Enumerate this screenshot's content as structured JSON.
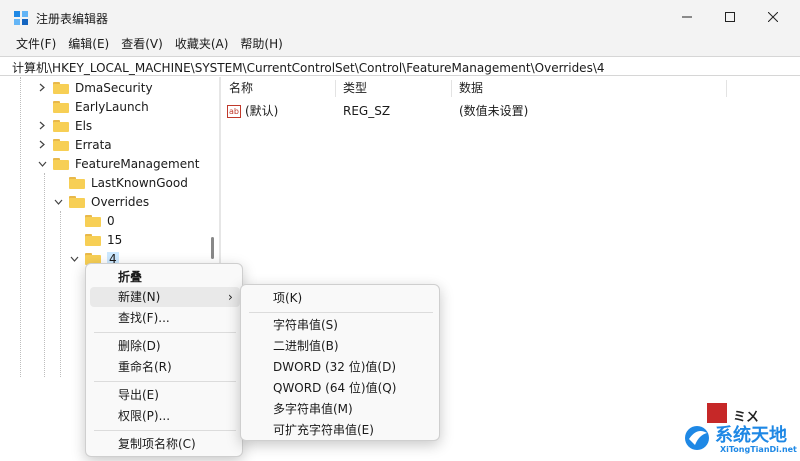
{
  "window": {
    "title": "注册表编辑器",
    "buttons": {
      "minimize": "—",
      "maximize": "☐",
      "close": "✕"
    }
  },
  "menubar": [
    "文件(F)",
    "编辑(E)",
    "查看(V)",
    "收藏夹(A)",
    "帮助(H)"
  ],
  "address": "计算机\\HKEY_LOCAL_MACHINE\\SYSTEM\\CurrentControlSet\\Control\\FeatureManagement\\Overrides\\4",
  "tree": [
    {
      "label": "DmaSecurity",
      "expanded": false
    },
    {
      "label": "EarlyLaunch",
      "expanded": null
    },
    {
      "label": "Els",
      "expanded": false
    },
    {
      "label": "Errata",
      "expanded": false
    },
    {
      "label": "FeatureManagement",
      "expanded": true
    },
    {
      "label": "LastKnownGood",
      "expanded": null
    },
    {
      "label": "Overrides",
      "expanded": true
    },
    {
      "label": "0",
      "expanded": null
    },
    {
      "label": "15",
      "expanded": null
    },
    {
      "label": "4",
      "expanded": true,
      "selected": true
    }
  ],
  "list": {
    "headers": [
      "名称",
      "类型",
      "数据"
    ],
    "rows": [
      {
        "name": "(默认)",
        "type": "REG_SZ",
        "data": "(数值未设置)",
        "icon": "ab-string-icon",
        "icon_text": "ab"
      }
    ]
  },
  "context_menu": {
    "items": [
      {
        "label": "折叠",
        "bold": true
      },
      {
        "label": "新建(N)",
        "submenu": true,
        "arrow": "›"
      },
      {
        "label": "查找(F)..."
      },
      {
        "label": "删除(D)"
      },
      {
        "label": "重命名(R)"
      },
      {
        "label": "导出(E)"
      },
      {
        "label": "权限(P)..."
      },
      {
        "label": "复制项名称(C)"
      }
    ]
  },
  "submenu": {
    "items": [
      "项(K)",
      "字符串值(S)",
      "二进制值(B)",
      "DWORD (32 位)值(D)",
      "QWORD (64 位)值(Q)",
      "多字符串值(M)",
      "可扩充字符串值(E)"
    ]
  },
  "watermark": {
    "brand": "系统天地",
    "url": "XiTongTianDi.net",
    "top_text": "ミㄨ"
  },
  "colors": {
    "selection": "#cce8ff",
    "folder": "#f7cf55",
    "brand_blue": "#1e88e5",
    "logo_red": "#c62828"
  }
}
